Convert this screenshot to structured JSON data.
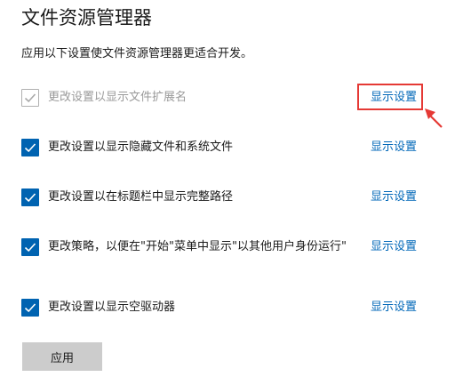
{
  "header": {
    "title": "文件资源管理器"
  },
  "description": "应用以下设置使文件资源管理器更适合开发。",
  "settings": [
    {
      "label": "更改设置以显示文件扩展名",
      "link": "显示设置",
      "checked": true,
      "disabled": true
    },
    {
      "label": "更改设置以显示隐藏文件和系统文件",
      "link": "显示设置",
      "checked": true,
      "disabled": false
    },
    {
      "label": "更改设置以在标题栏中显示完整路径",
      "link": "显示设置",
      "checked": true,
      "disabled": false
    },
    {
      "label": "更改策略，以便在\"开始\"菜单中显示\"以其他用户身份运行\"",
      "link": "显示设置",
      "checked": true,
      "disabled": false
    },
    {
      "label": "更改设置以显示空驱动器",
      "link": "显示设置",
      "checked": true,
      "disabled": false
    }
  ],
  "apply_label": "应用",
  "colors": {
    "accent": "#0063b1",
    "link": "#0067b8",
    "annotation": "#e53935"
  }
}
